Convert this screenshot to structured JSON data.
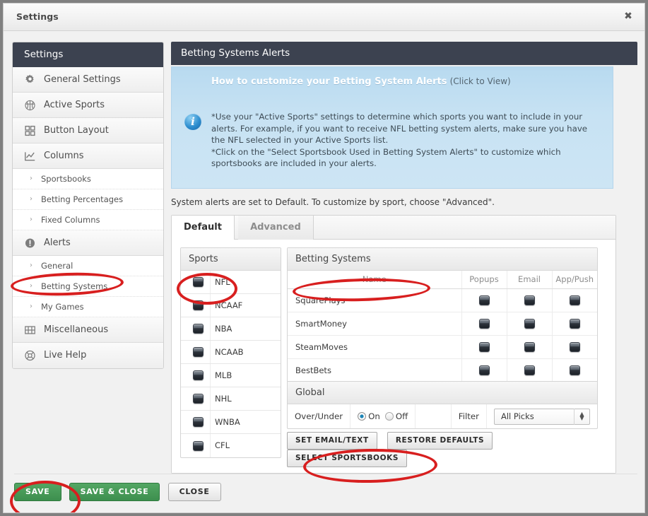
{
  "window": {
    "title": "Settings",
    "close_icon": "close-icon"
  },
  "sidebar": {
    "header": "Settings",
    "items": [
      {
        "label": "General Settings",
        "icon": "gear-icon",
        "type": "main"
      },
      {
        "label": "Active Sports",
        "icon": "basketball-icon",
        "type": "main"
      },
      {
        "label": "Button Layout",
        "icon": "grid-icon",
        "type": "main"
      },
      {
        "label": "Columns",
        "icon": "chart-icon",
        "type": "main"
      },
      {
        "label": "Sportsbooks",
        "icon": "chevron-right-icon",
        "type": "sub"
      },
      {
        "label": "Betting Percentages",
        "icon": "chevron-right-icon",
        "type": "sub"
      },
      {
        "label": "Fixed Columns",
        "icon": "chevron-right-icon",
        "type": "sub"
      },
      {
        "label": "Alerts",
        "icon": "alert-icon",
        "type": "main"
      },
      {
        "label": "General",
        "icon": "chevron-right-icon",
        "type": "sub"
      },
      {
        "label": "Betting Systems",
        "icon": "chevron-right-icon",
        "type": "sub"
      },
      {
        "label": "My Games",
        "icon": "chevron-right-icon",
        "type": "sub"
      },
      {
        "label": "Miscellaneous",
        "icon": "misc-icon",
        "type": "main"
      },
      {
        "label": "Live Help",
        "icon": "lifebuoy-icon",
        "type": "main"
      }
    ]
  },
  "main": {
    "header": "Betting Systems Alerts",
    "info": {
      "howto_strong": "How to customize your  Betting System Alerts",
      "howto_click": "(Click to View)",
      "body": "*Use your \"Active Sports\" settings to determine which sports you want to include in your alerts. For example, if you want to receive NFL betting system alerts, make sure you have the NFL selected in your Active Sports list.\n*Click on the \"Select Sportsbook Used in Betting System Alerts\" to customize which sportsbooks are included in your alerts.",
      "icon": "info-icon"
    },
    "hint": "System alerts are set to Default. To customize by sport, choose \"Advanced\".",
    "tabs": [
      {
        "label": "Default",
        "active": true
      },
      {
        "label": "Advanced",
        "active": false
      }
    ],
    "sports_panel": {
      "header": "Sports",
      "items": [
        "NFL",
        "NCAAF",
        "NBA",
        "NCAAB",
        "MLB",
        "NHL",
        "WNBA",
        "CFL"
      ]
    },
    "betting_systems": {
      "header": "Betting Systems",
      "columns": [
        "Name",
        "Popups",
        "Email",
        "App/Push"
      ],
      "rows": [
        {
          "name": "SquarePlays",
          "popups": true,
          "email": true,
          "app_push": true
        },
        {
          "name": "SmartMoney",
          "popups": true,
          "email": true,
          "app_push": true
        },
        {
          "name": "SteamMoves",
          "popups": true,
          "email": true,
          "app_push": true
        },
        {
          "name": "BestBets",
          "popups": true,
          "email": true,
          "app_push": true
        }
      ]
    },
    "global": {
      "header": "Global",
      "over_under_label": "Over/Under",
      "radio_on": "On",
      "radio_off": "Off",
      "radio_selected": "On",
      "filter_label": "Filter",
      "filter_value": "All Picks"
    },
    "action_buttons": [
      "SET EMAIL/TEXT",
      "RESTORE DEFAULTS",
      "SELECT SPORTSBOOKS"
    ]
  },
  "footer": {
    "buttons": [
      {
        "label": "SAVE",
        "style": "green"
      },
      {
        "label": "SAVE & CLOSE",
        "style": "green"
      },
      {
        "label": "CLOSE",
        "style": "grey"
      }
    ]
  },
  "annotations": {
    "color": "#d81f1f",
    "ellipses": [
      "betting-systems-nav-item",
      "sports-panel-header",
      "notification-columns-headers",
      "select-sportsbooks-button",
      "save-button"
    ]
  }
}
